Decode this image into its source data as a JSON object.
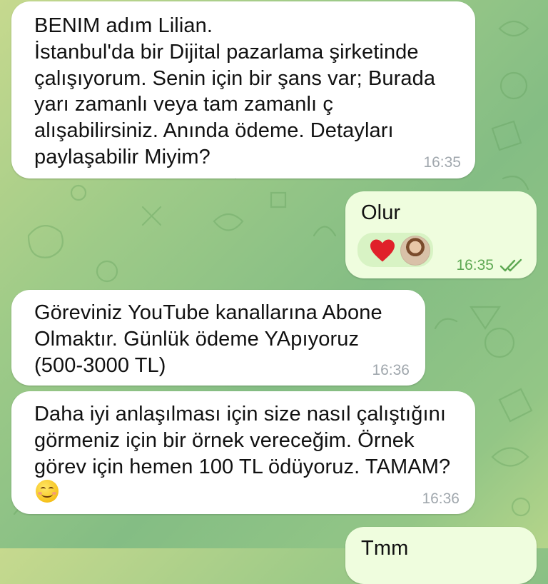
{
  "chat": {
    "messages": [
      {
        "direction": "incoming",
        "text": "BENIM adım  Lilian.\nİstanbul'da bir Dijital pazarlama şirketinde çalışıyorum. Senin için bir şans var; Burada yarı zamanlı veya tam zamanlı ç\nalışabilirsiniz. Anında ödeme. Detayları paylaşabilir Miyim?",
        "time": "16:35"
      },
      {
        "direction": "outgoing",
        "text": "Olur",
        "time": "16:35",
        "status": "read",
        "reaction": {
          "emoji": "heart",
          "color": "#e0202a"
        }
      },
      {
        "direction": "incoming",
        "text": "Göreviniz  YouTube kanallarına Abone Olmaktır. Günlük ödeme YApıyoruz (500-3000 TL)",
        "time": "16:36"
      },
      {
        "direction": "incoming",
        "text": "Daha  iyi anlaşılması için size nasıl çalıştığını görmeniz için bir örnek vereceğim. Örnek görev için hemen 100 TL ödüyoruz. TAMAM?",
        "emoji": "smiling-face",
        "time": "16:36"
      },
      {
        "direction": "outgoing",
        "text": "Tmm"
      }
    ]
  },
  "colors": {
    "incoming_bubble": "#ffffff",
    "outgoing_bubble": "#effdde",
    "outgoing_time": "#5ea853",
    "incoming_time": "#a0a7ad",
    "reaction_pill": "#d8f3c4"
  }
}
